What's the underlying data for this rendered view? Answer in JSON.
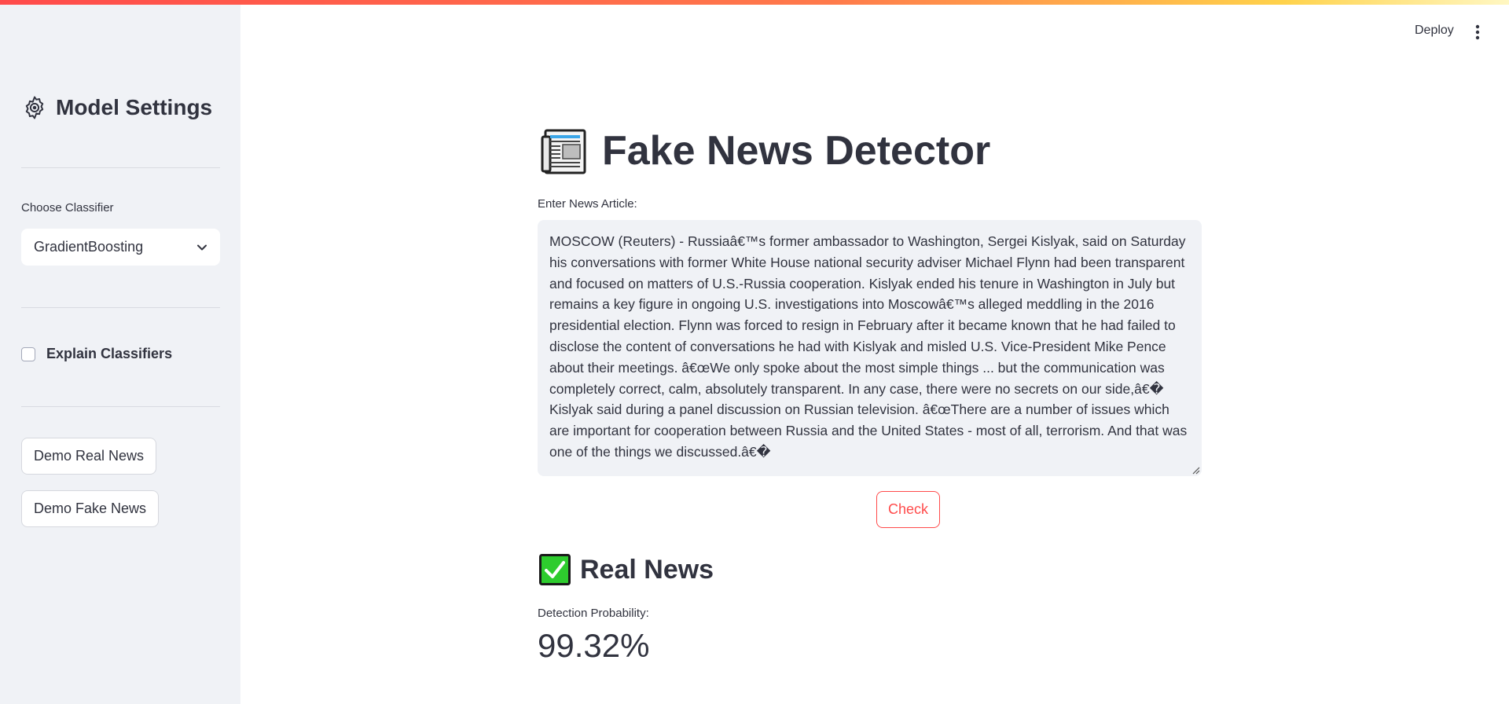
{
  "header": {
    "deploy_label": "Deploy",
    "menu_icon": "kebab-menu-icon"
  },
  "sidebar": {
    "title": "Model Settings",
    "title_icon": "gear-icon",
    "classifier_label": "Choose Classifier",
    "classifier_selected": "GradientBoosting",
    "explain_label": "Explain Classifiers",
    "explain_checked": false,
    "demo_real_label": "Demo Real News",
    "demo_fake_label": "Demo Fake News"
  },
  "main": {
    "title": "Fake News Detector",
    "title_icon": "newspaper-icon",
    "article_label": "Enter News Article:",
    "article_text": "MOSCOW (Reuters) - Russiaâ€™s former ambassador to Washington, Sergei Kislyak, said on Saturday his conversations with former White House national security adviser Michael Flynn had been transparent and focused on matters of U.S.-Russia cooperation. Kislyak ended his tenure in Washington in July but remains a key figure in ongoing U.S. investigations into Moscowâ€™s alleged meddling in the 2016 presidential election. Flynn was forced to resign in February after it became known that he had failed to disclose the content of conversations he had with Kislyak and misled U.S. Vice-President Mike Pence about their meetings. â€œWe only spoke about the most simple things ... but the communication was completely correct, calm, absolutely transparent. In any case, there were no secrets on our side,â€� Kislyak said during a panel discussion on Russian television. â€œThere are a number of issues which are important for cooperation between Russia and the United States - most of all, terrorism. And that was one of the things we discussed.â€�",
    "check_label": "Check",
    "result_label": "Real News",
    "result_icon": "check-mark-icon",
    "probability_label": "Detection Probability:",
    "probability_value": "99.32%"
  },
  "colors": {
    "accent": "#ff4b4b",
    "sidebar_bg": "#f0f2f6",
    "text": "#31333f",
    "check_green": "#2ecc2e"
  }
}
